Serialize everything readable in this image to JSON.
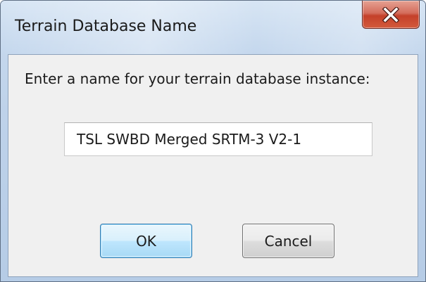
{
  "window": {
    "title": "Terrain Database Name",
    "close_icon": "close-x-icon"
  },
  "dialog": {
    "prompt": "Enter a name for your terrain database instance:",
    "name_value": "TSL SWBD Merged SRTM-3 V2-1",
    "ok_label": "OK",
    "cancel_label": "Cancel"
  },
  "colors": {
    "close_button": "#c4402a",
    "ok_button_border": "#3c7fb1",
    "client_background": "#f0f0f0"
  }
}
